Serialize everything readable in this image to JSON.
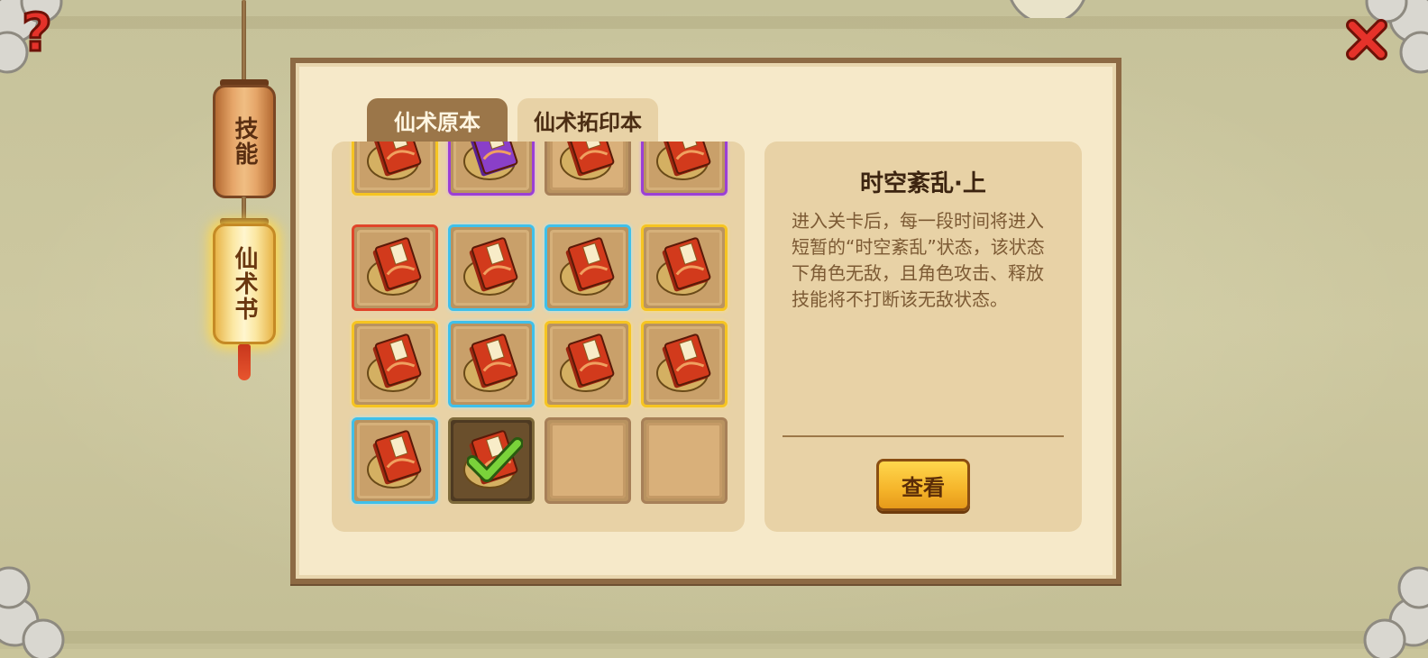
{
  "side_nav": {
    "items": [
      {
        "label": "技能",
        "active": false
      },
      {
        "label": "仙术书",
        "active": true
      }
    ]
  },
  "tabs": [
    {
      "label": "仙术原本",
      "active": false
    },
    {
      "label": "仙术拓印本",
      "active": true
    }
  ],
  "grid": {
    "rarity_colors": {
      "gold": "#f6c421",
      "blue": "#3fc0ea",
      "red": "#e0452a",
      "purple": "#9b3fd5"
    },
    "slots": [
      {
        "rarity": "gold",
        "book": "red-book"
      },
      {
        "rarity": "purple",
        "book": "purple-book"
      },
      {
        "rarity": "empty",
        "book": "red-book"
      },
      {
        "rarity": "purple",
        "book": "red-book"
      },
      {
        "rarity": "red",
        "book": "red-book"
      },
      {
        "rarity": "blue",
        "book": "red-book"
      },
      {
        "rarity": "blue",
        "book": "red-book"
      },
      {
        "rarity": "gold",
        "book": "red-book"
      },
      {
        "rarity": "gold",
        "book": "red-book"
      },
      {
        "rarity": "blue",
        "book": "red-book"
      },
      {
        "rarity": "gold",
        "book": "red-book"
      },
      {
        "rarity": "gold",
        "book": "red-book"
      },
      {
        "rarity": "blue",
        "book": "red-book"
      },
      {
        "rarity": "owned",
        "book": "red-book",
        "checked": true
      },
      {
        "rarity": "empty",
        "book": null
      },
      {
        "rarity": "empty",
        "book": null
      }
    ]
  },
  "detail": {
    "title": "时空紊乱·上",
    "description": "进入关卡后，每一段时间将进入短暂的“时空紊乱”状态，该状态下角色无敌，且角色攻击、释放技能将不打断该无敌状态。",
    "view_button": "查看"
  },
  "icons": {
    "help": "question-mark-icon",
    "close": "close-x-icon"
  }
}
